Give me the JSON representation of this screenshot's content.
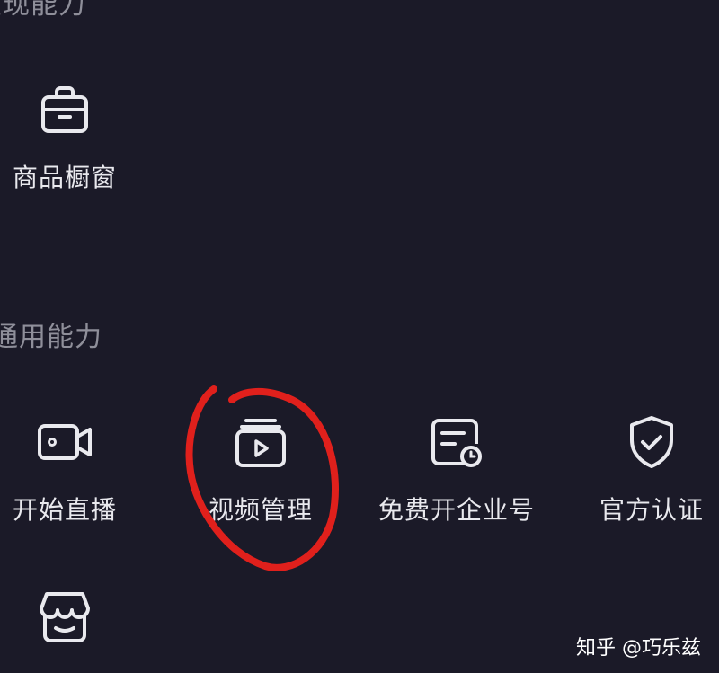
{
  "sections": {
    "commerce": {
      "title": "变现能力",
      "items": [
        {
          "label": "商品橱窗",
          "icon": "briefcase-icon"
        }
      ]
    },
    "general": {
      "title": "通用能力",
      "items": [
        {
          "label": "开始直播",
          "icon": "video-camera-icon"
        },
        {
          "label": "视频管理",
          "icon": "video-manage-icon"
        },
        {
          "label": "免费开企业号",
          "icon": "enterprise-account-icon"
        },
        {
          "label": "官方认证",
          "icon": "shield-check-icon"
        },
        {
          "label": "",
          "icon": "store-icon"
        }
      ]
    }
  },
  "watermark": "知乎 @巧乐兹",
  "colors": {
    "background": "#1b1a28",
    "text": "#e9e9ee",
    "section_title": "#8f8f9a",
    "annotation": "#e0201c"
  }
}
